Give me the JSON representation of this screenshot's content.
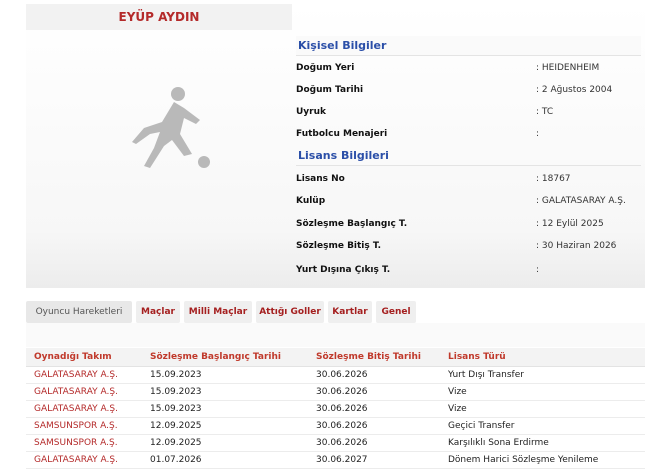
{
  "player": {
    "name": "EYÜP AYDIN"
  },
  "personal": {
    "title": "Kişisel Bilgiler",
    "rows": [
      {
        "label": "Doğum Yeri",
        "value": ": HEIDENHEIM"
      },
      {
        "label": "Doğum Tarihi",
        "value": ": 2 Ağustos 2004"
      },
      {
        "label": "Uyruk",
        "value": ": TC"
      },
      {
        "label": "Futbolcu Menajeri",
        "value": ":"
      }
    ]
  },
  "license": {
    "title": "Lisans Bilgileri",
    "rows": [
      {
        "label": "Lisans No",
        "value": ": 18767"
      },
      {
        "label": "Kulüp",
        "value": ": GALATASARAY A.Ş."
      },
      {
        "label": "Sözleşme Başlangıç T.",
        "value": ": 12 Eylül 2025"
      },
      {
        "label": "Sözleşme Bitiş T.",
        "value": ": 30 Haziran 2026"
      },
      {
        "label": "Yurt Dışına Çıkış T.",
        "value": ":"
      }
    ]
  },
  "tabs": [
    "Oyuncu Hareketleri",
    "Maçlar",
    "Milli Maçlar",
    "Attığı Goller",
    "Kartlar",
    "Genel"
  ],
  "active_tab": "Oyuncu Hareketleri",
  "transfers": {
    "headers": [
      "Oynadığı Takım",
      "Sözleşme Başlangıç Tarihi",
      "Sözleşme Bitiş Tarihi",
      "Lisans Türü"
    ],
    "rows": [
      [
        "GALATASARAY A.Ş.",
        "15.09.2023",
        "30.06.2026",
        "Yurt Dışı Transfer"
      ],
      [
        "GALATASARAY A.Ş.",
        "15.09.2023",
        "30.06.2026",
        "Vize"
      ],
      [
        "GALATASARAY A.Ş.",
        "15.09.2023",
        "30.06.2026",
        "Vize"
      ],
      [
        "SAMSUNSPOR A.Ş.",
        "12.09.2025",
        "30.06.2026",
        "Geçici Transfer"
      ],
      [
        "SAMSUNSPOR A.Ş.",
        "12.09.2025",
        "30.06.2026",
        "Karşılıklı Sona Erdirme"
      ],
      [
        "GALATASARAY A.Ş.",
        "01.07.2026",
        "30.06.2027",
        "Dönem Harici Sözleşme Yenileme"
      ]
    ]
  },
  "colors": {
    "accent_red": "#b42a2a",
    "section_blue": "#2b4fa8"
  },
  "icons": {
    "photo_placeholder": "football-player-silhouette-icon"
  }
}
